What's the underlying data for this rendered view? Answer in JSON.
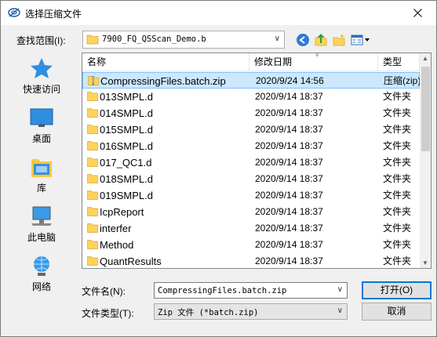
{
  "window": {
    "title": "选择压缩文件"
  },
  "lookin": {
    "label": "查找范围(I):",
    "path": "7900_FQ_QSScan_Demo.b"
  },
  "places": [
    {
      "label": "快速访问",
      "icon": "star-icon"
    },
    {
      "label": "桌面",
      "icon": "desktop-icon"
    },
    {
      "label": "库",
      "icon": "library-icon"
    },
    {
      "label": "此电脑",
      "icon": "computer-icon"
    },
    {
      "label": "网络",
      "icon": "network-icon"
    }
  ],
  "columns": {
    "name": "名称",
    "date": "修改日期",
    "type": "类型"
  },
  "files": [
    {
      "name": "CompressingFiles.batch.zip",
      "date": "2020/9/24 14:56",
      "type": "压缩(zip)",
      "icon": "zip-icon",
      "selected": true
    },
    {
      "name": "013SMPL.d",
      "date": "2020/9/14 18:37",
      "type": "文件夹",
      "icon": "folder-icon"
    },
    {
      "name": "014SMPL.d",
      "date": "2020/9/14 18:37",
      "type": "文件夹",
      "icon": "folder-icon"
    },
    {
      "name": "015SMPL.d",
      "date": "2020/9/14 18:37",
      "type": "文件夹",
      "icon": "folder-icon"
    },
    {
      "name": "016SMPL.d",
      "date": "2020/9/14 18:37",
      "type": "文件夹",
      "icon": "folder-icon"
    },
    {
      "name": "017_QC1.d",
      "date": "2020/9/14 18:37",
      "type": "文件夹",
      "icon": "folder-icon"
    },
    {
      "name": "018SMPL.d",
      "date": "2020/9/14 18:37",
      "type": "文件夹",
      "icon": "folder-icon"
    },
    {
      "name": "019SMPL.d",
      "date": "2020/9/14 18:37",
      "type": "文件夹",
      "icon": "folder-icon"
    },
    {
      "name": "IcpReport",
      "date": "2020/9/14 18:37",
      "type": "文件夹",
      "icon": "folder-icon"
    },
    {
      "name": "interfer",
      "date": "2020/9/14 18:37",
      "type": "文件夹",
      "icon": "folder-icon"
    },
    {
      "name": "Method",
      "date": "2020/9/14 18:37",
      "type": "文件夹",
      "icon": "folder-icon"
    },
    {
      "name": "QuantResults",
      "date": "2020/9/14 18:37",
      "type": "文件夹",
      "icon": "folder-icon"
    }
  ],
  "filename": {
    "label": "文件名(N):",
    "value": "CompressingFiles.batch.zip"
  },
  "filetype": {
    "label": "文件类型(T):",
    "value": "Zip 文件 (*batch.zip)"
  },
  "buttons": {
    "open": "打开(O)",
    "cancel": "取消"
  },
  "colors": {
    "selection": "#cce8ff",
    "accent": "#0078d7",
    "folder": "#ffd25c"
  }
}
